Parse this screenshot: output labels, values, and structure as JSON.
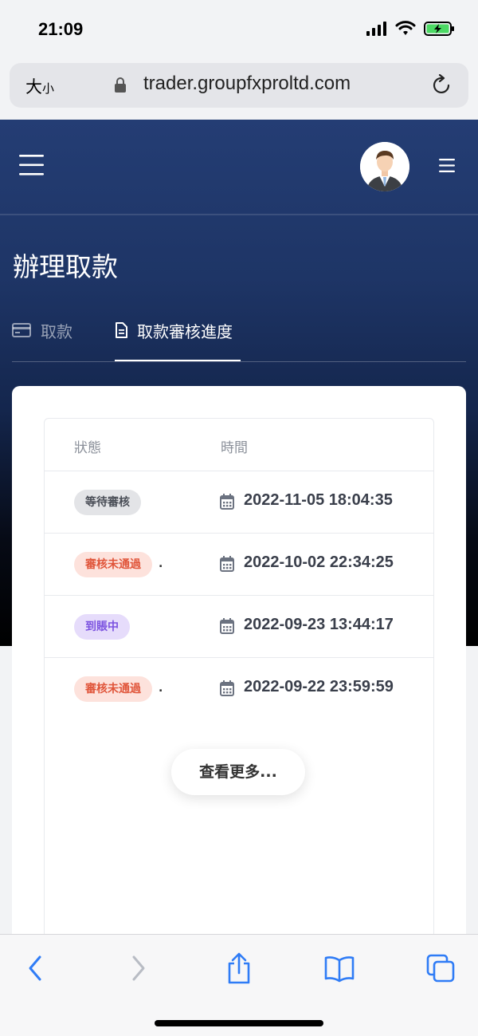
{
  "status_bar": {
    "time": "21:09"
  },
  "browser": {
    "text_size_label_big": "大",
    "text_size_label_small": "小",
    "url": "trader.groupfxproltd.com"
  },
  "page": {
    "title": "辦理取款"
  },
  "tabs": [
    {
      "label": "取款",
      "icon": "credit-card-icon"
    },
    {
      "label": "取款審核進度",
      "icon": "document-icon"
    }
  ],
  "table": {
    "headers": {
      "status": "狀態",
      "time": "時間"
    },
    "rows": [
      {
        "status": "等待審核",
        "status_color": "#e3e4e7",
        "time": "2022-11-05 18:04:35",
        "trailing": ""
      },
      {
        "status": "審核未通過",
        "status_color": "#fde2dc",
        "time": "2022-10-02 22:34:25",
        "trailing": "."
      },
      {
        "status": "到賬中",
        "status_color": "#e6dcfb",
        "time": "2022-09-23 13:44:17",
        "trailing": ""
      },
      {
        "status": "審核未通過",
        "status_color": "#fde2dc",
        "time": "2022-09-22 23:59:59",
        "trailing": "."
      }
    ]
  },
  "more_button": {
    "label": "查看更多..."
  }
}
